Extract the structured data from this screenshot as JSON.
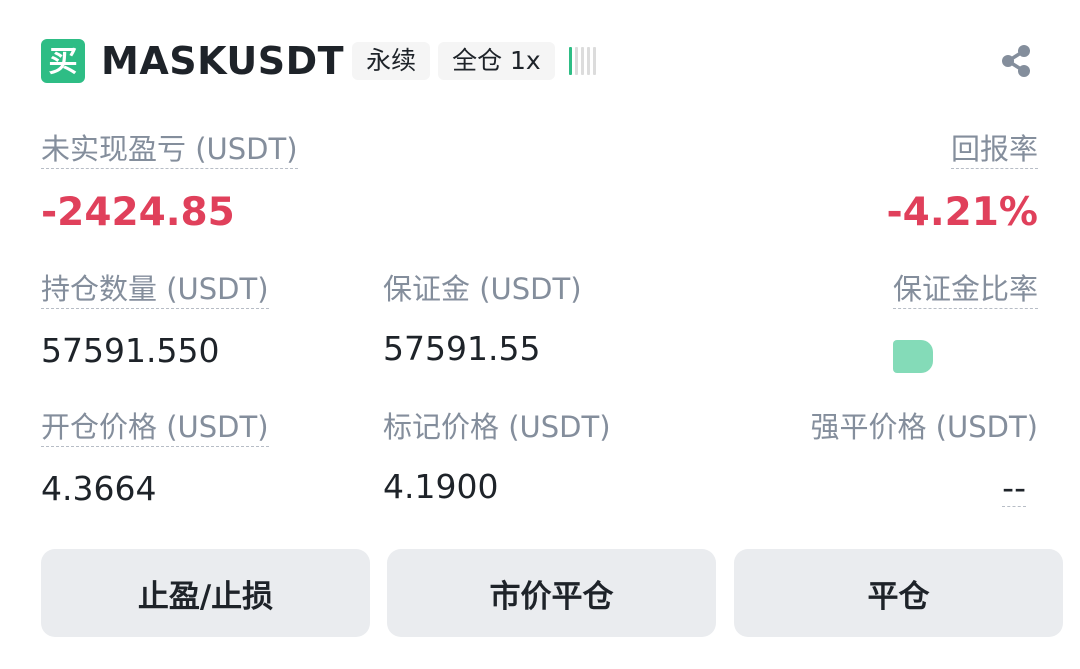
{
  "header": {
    "side_badge": "买",
    "symbol": "MASKUSDT",
    "contract_type": "永续",
    "margin_mode": "全仓 1x",
    "risk_level": 1,
    "risk_level_max": 5,
    "share_icon": "share-icon"
  },
  "pnl": {
    "label": "未实现盈亏 (USDT)",
    "value": "-2424.85"
  },
  "roe": {
    "label": "回报率",
    "value": "-4.21%"
  },
  "size": {
    "label": "持仓数量 (USDT)",
    "value": "57591.550"
  },
  "margin": {
    "label": "保证金 (USDT)",
    "value": "57591.55"
  },
  "margin_ratio": {
    "label": "保证金比率"
  },
  "entry_price": {
    "label": "开仓价格 (USDT)",
    "value": "4.3664"
  },
  "mark_price": {
    "label": "标记价格 (USDT)",
    "value": "4.1900"
  },
  "liq_price": {
    "label": "强平价格 (USDT)",
    "value": "--"
  },
  "buttons": {
    "tpsl": "止盈/止损",
    "market_close": "市价平仓",
    "close": "平仓"
  },
  "colors": {
    "buy_green": "#2ebd85",
    "loss_red": "#e0405b",
    "muted_text": "#848e9c",
    "button_bg": "#eaecef"
  }
}
